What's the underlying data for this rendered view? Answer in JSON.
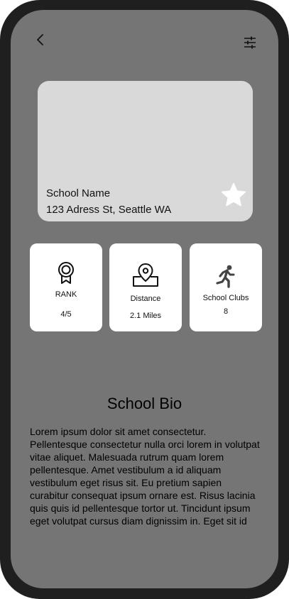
{
  "header": {
    "back_icon": "chevron-left-icon",
    "filter_icon": "sliders-icon"
  },
  "school": {
    "name": "School Name",
    "address": "123 Adress St, Seattle WA",
    "favorite_icon": "star-icon"
  },
  "stats": [
    {
      "icon": "award-ribbon-icon",
      "label": "RANK",
      "value": "4/5"
    },
    {
      "icon": "map-pin-icon",
      "label": "Distance",
      "value": "2.1 Miles"
    },
    {
      "icon": "running-person-icon",
      "label": "School Clubs",
      "value": "8"
    }
  ],
  "bio": {
    "title": "School Bio",
    "text": "Lorem ipsum dolor sit amet consectetur. Pellentesque consectetur nulla orci lorem in volutpat vitae aliquet. Malesuada rutrum quam lorem pellentesque. Amet vestibulum a id aliquam vestibulum eget risus sit. Eu pretium sapien curabitur consequat ipsum ornare est. Risus lacinia quis quis id pellentesque tortor ut. Tincidunt ipsum eget volutpat cursus diam dignissim in. Eget sit id"
  },
  "colors": {
    "screen_bg": "#767575",
    "frame": "#1f1f1f",
    "hero_bg": "#d9d9d9",
    "card_bg": "#ffffff"
  }
}
